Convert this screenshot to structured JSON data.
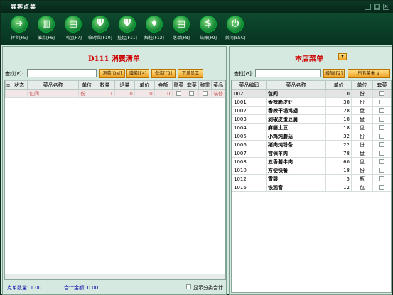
{
  "window": {
    "title": "宾客点菜",
    "min": "_",
    "max": "□",
    "close": "×"
  },
  "toolbar": [
    {
      "label": "转台[F5]",
      "icon": "arrow-icon",
      "glyph": "➜"
    },
    {
      "label": "催菜[F6]",
      "icon": "bank-icon",
      "glyph": "▥"
    },
    {
      "label": "叫起[F7]",
      "icon": "doc-icon",
      "glyph": "▤"
    },
    {
      "label": "临时菜[F10]",
      "icon": "fork-icon",
      "glyph": "Ψ"
    },
    {
      "label": "挂起[F11]",
      "icon": "tool-icon",
      "glyph": "Ψ"
    },
    {
      "label": "解挂[F12]",
      "icon": "tie-icon",
      "glyph": "♦"
    },
    {
      "label": "落单[F8]",
      "icon": "note-icon",
      "glyph": "▤"
    },
    {
      "label": "结账[F9]",
      "icon": "dollar-icon",
      "glyph": "$"
    },
    {
      "label": "关闭[ESC]",
      "icon": "power-icon",
      "glyph": "⏻"
    }
  ],
  "left": {
    "title": "D111  消费清单",
    "search_label": "查找[F]:",
    "search_value": "",
    "buttons": [
      "退菜[Del]",
      "赠菜[F4]",
      "做法[F3]",
      "下单员工"
    ],
    "columns": [
      "状态",
      "菜品名称",
      "单位",
      "数量",
      "退量",
      "单价",
      "金额",
      "赠菜",
      "套菜",
      "称重",
      "菜品"
    ],
    "rows": [
      {
        "no": "1",
        "status": "",
        "name": "包间",
        "unit": "份",
        "qty": "1",
        "ret": "0",
        "price": "0",
        "amount": "0",
        "extra": "装修"
      }
    ],
    "footer": {
      "count_label": "点单数量: 1.00",
      "total_label": "合计金额: 0.00",
      "show_category_label": "显示分类合计"
    }
  },
  "right": {
    "title": "本店菜单",
    "search_label": "查找[G]:",
    "search_value": "",
    "buttons": [
      "增加[F2]",
      "所有菜类 ↓"
    ],
    "columns": [
      "菜品编码",
      "菜品名称",
      "单价",
      "单位",
      "套菜"
    ],
    "rows": [
      {
        "code": "002",
        "name": "包间",
        "price": "0",
        "unit": "份"
      },
      {
        "code": "1001",
        "name": "香辣脆皮虾",
        "price": "38",
        "unit": "份"
      },
      {
        "code": "1002",
        "name": "香辣干锅鸡翅",
        "price": "28",
        "unit": "盘"
      },
      {
        "code": "1003",
        "name": "剁椒皮蛋豆腐",
        "price": "18",
        "unit": "盘"
      },
      {
        "code": "1004",
        "name": "麻婆土豆",
        "price": "18",
        "unit": "盘"
      },
      {
        "code": "1005",
        "name": "小鸡炖蘑菇",
        "price": "32",
        "unit": "份"
      },
      {
        "code": "1006",
        "name": "猪肉炖粉条",
        "price": "22",
        "unit": "份"
      },
      {
        "code": "1007",
        "name": "宫保羊肉",
        "price": "78",
        "unit": "盘"
      },
      {
        "code": "1008",
        "name": "五香酱牛肉",
        "price": "60",
        "unit": "盘"
      },
      {
        "code": "1010",
        "name": "方便快餐",
        "price": "18",
        "unit": "份"
      },
      {
        "code": "1012",
        "name": "雪碧",
        "price": "5",
        "unit": "瓶"
      },
      {
        "code": "1016",
        "name": "铁观音",
        "price": "12",
        "unit": "包"
      }
    ]
  }
}
